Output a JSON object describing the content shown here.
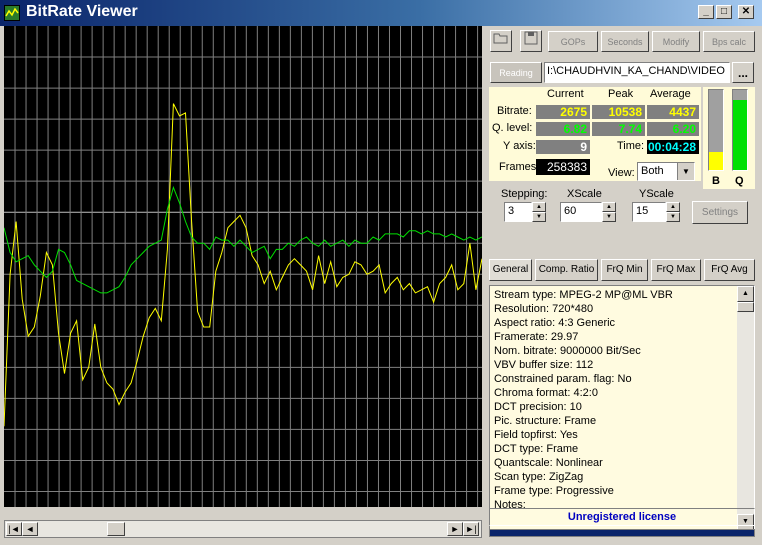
{
  "window": {
    "title": "BitRate Viewer"
  },
  "toolbar": {
    "open_icon": "folder-open-icon",
    "save_icon": "floppy-disk-icon",
    "gops": "GOPs",
    "seconds": "Seconds",
    "modify": "Modify",
    "bps_calc": "Bps calc"
  },
  "file": {
    "reading_label": "Reading",
    "path": "I:\\CHAUDHVIN_KA_CHAND\\VIDEO",
    "browse_label": "..."
  },
  "stats": {
    "headers": {
      "current": "Current",
      "peak": "Peak",
      "average": "Average"
    },
    "bitrate": {
      "label": "Bitrate:",
      "current": "2675",
      "peak": "10538",
      "average": "4437"
    },
    "qlevel": {
      "label": "Q. level:",
      "current": "6.82",
      "peak": "7.74",
      "average": "6.20"
    },
    "yaxis": {
      "label": "Y axis:",
      "value": "9"
    },
    "time": {
      "label": "Time:",
      "value": "00:04:28"
    },
    "frames": {
      "label": "Frames:",
      "value": "258383"
    },
    "view": {
      "label": "View:",
      "value": "Both"
    }
  },
  "meters": {
    "b_label": "B",
    "q_label": "Q",
    "b_level": 0.22,
    "q_level": 0.88,
    "b_color": "#ffff00",
    "q_color": "#00e000"
  },
  "controls": {
    "stepping": {
      "label": "Stepping:",
      "value": "3"
    },
    "xscale": {
      "label": "XScale",
      "value": "60"
    },
    "yscale": {
      "label": "YScale",
      "value": "15"
    },
    "settings": "Settings"
  },
  "tabs": [
    "General",
    "Comp. Ratio",
    "FrQ Min",
    "FrQ Max",
    "FrQ Avg"
  ],
  "info": [
    "Stream type: MPEG-2  MP@ML  VBR",
    "Resolution: 720*480",
    "Aspect ratio: 4:3 Generic",
    "Framerate: 29.97",
    "Nom. bitrate: 9000000 Bit/Sec",
    "VBV buffer size: 112",
    "Constrained param. flag: No",
    "Chroma format: 4:2:0",
    "DCT precision: 10",
    "Pic. structure: Frame",
    "Field topfirst: Yes",
    "DCT type: Frame",
    "Quantscale: Nonlinear",
    "Scan type: ZigZag",
    "Frame type: Progressive",
    "Notes:"
  ],
  "status": "Unregistered license",
  "chart_data": {
    "type": "line",
    "grid": true,
    "ylim": [
      0,
      15
    ],
    "series": [
      {
        "color": "#ffff00",
        "values": [
          2.6,
          7.5,
          9.2,
          6.7,
          5.5,
          5.8,
          6.8,
          8.2,
          7.8,
          5.6,
          4.3,
          5.6,
          6.0,
          4.1,
          4.5,
          5.9,
          4.5,
          4.0,
          3.8,
          3.3,
          3.7,
          4.0,
          4.7,
          5.5,
          6.1,
          6.4,
          6.0,
          8.3,
          13.0,
          12.6,
          12.7,
          9.2,
          6.3,
          5.8,
          5.8,
          7.6,
          8.2,
          9.0,
          9.2,
          9.4,
          9.0,
          8.1,
          7.8,
          7.2,
          7.6,
          7.0,
          7.4,
          7.8,
          8.0,
          7.8,
          7.6,
          7.0,
          8.1,
          7.2,
          7.9,
          7.1,
          7.4,
          7.5,
          7.9,
          7.8,
          7.5,
          7.6,
          7.8,
          6.9,
          7.2,
          7.4,
          7.0,
          7.2,
          6.9,
          7.0,
          7.1,
          6.6,
          7.2,
          7.4,
          7.8,
          7.0,
          7.2,
          8.5,
          7.0,
          8.0
        ]
      },
      {
        "color": "#00e000",
        "values": [
          9.0,
          8.2,
          7.9,
          8.0,
          8.1,
          7.8,
          7.6,
          7.4,
          7.6,
          8.3,
          8.2,
          7.8,
          7.3,
          7.2,
          7.1,
          7.0,
          6.9,
          6.9,
          7.0,
          7.1,
          7.4,
          7.8,
          8.0,
          8.2,
          8.4,
          8.5,
          8.6,
          9.6,
          10.3,
          9.8,
          9.2,
          8.7,
          8.5,
          8.5,
          8.3,
          8.7,
          8.6,
          8.6,
          8.4,
          8.6,
          8.4,
          8.2,
          8.3,
          8.4,
          8.0,
          8.3,
          8.3,
          8.5,
          8.4,
          8.6,
          8.7,
          8.5,
          8.4,
          8.6,
          8.4,
          8.5,
          8.6,
          8.4,
          8.6,
          8.5,
          8.5,
          8.7,
          8.6,
          8.8,
          8.8,
          8.8,
          8.7,
          8.9,
          8.9,
          8.8,
          8.9,
          8.8,
          8.8,
          8.7,
          8.8,
          8.7,
          8.6,
          8.7,
          8.6,
          8.7
        ]
      }
    ]
  }
}
